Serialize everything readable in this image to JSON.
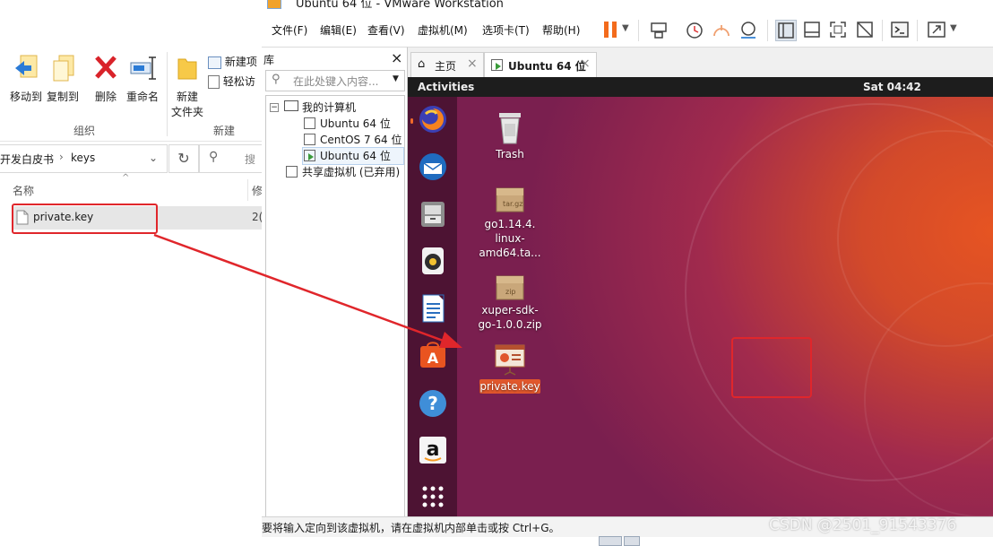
{
  "vmware": {
    "title": "Ubuntu 64 位 - VMware Workstation",
    "menu": [
      "文件(F)",
      "编辑(E)",
      "查看(V)",
      "虚拟机(M)",
      "选项卡(T)",
      "帮助(H)"
    ],
    "library": {
      "title": "库",
      "close": "×",
      "search_placeholder": "在此处键入内容...",
      "tree": {
        "root": "我的计算机",
        "vms": [
          "Ubuntu 64 位",
          "CentOS 7 64 位",
          "Ubuntu 64 位"
        ],
        "shared": "共享虚拟机 (已弃用)"
      }
    },
    "tabs": [
      {
        "label": "主页",
        "close": "×"
      },
      {
        "label": "Ubuntu 64 位",
        "close": "×"
      }
    ],
    "status_bar": "要将输入定向到该虚拟机，请在虚拟机内部单击或按 Ctrl+G。"
  },
  "ubuntu": {
    "activities": "Activities",
    "clock": "Sat 04:42",
    "dock_icons": [
      "firefox-icon",
      "thunderbird-icon",
      "files-icon",
      "rhythmbox-icon",
      "writer-icon",
      "software-icon",
      "help-icon",
      "amazon-icon",
      "apps-grid-icon"
    ],
    "desktop": {
      "trash": "Trash",
      "tar_badge": "tar.gz",
      "tar_name": [
        "go1.14.4.",
        "linux-",
        "amd64.ta..."
      ],
      "zip_badge": "zip",
      "zip_name": [
        "xuper-sdk-",
        "go-1.0.0.zip"
      ],
      "key_name": "private.key"
    }
  },
  "explorer": {
    "ribbon": {
      "move_to": "移动到",
      "copy_to": "复制到",
      "delete": "删除",
      "rename": "重命名",
      "new_folder": [
        "新建",
        "文件夹"
      ],
      "new_item": "新建项",
      "easy_access": "轻松访",
      "group_organize": "组织",
      "group_new": "新建"
    },
    "breadcrumb": {
      "parent": "开发白皮书",
      "sep": "›",
      "current": "keys"
    },
    "search_placeholder": "搜",
    "column_name": "名称",
    "column_modified": "修",
    "file": {
      "name": "private.key",
      "date_fragment": "2("
    }
  },
  "watermark": "CSDN @2501_91543376",
  "colors": {
    "highlight_red": "#e0262b",
    "ubuntu_orange": "#e65422",
    "ubuntu_purple": "#7a1f4f",
    "vm_pause": "#f36b1c"
  }
}
